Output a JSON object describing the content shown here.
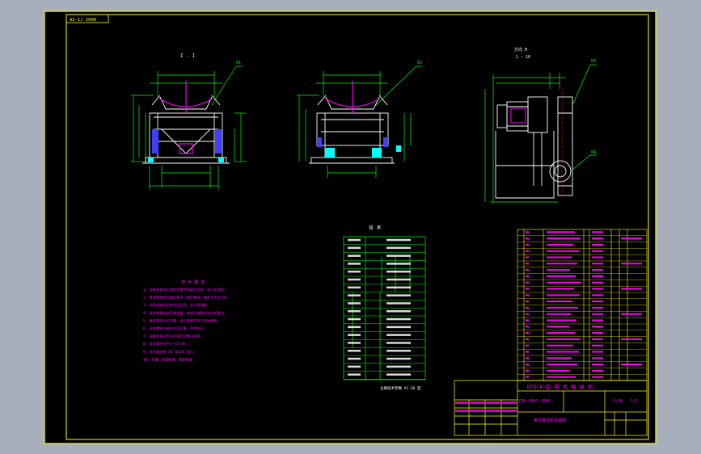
{
  "drawing": {
    "corner_label": "A3-1/ 1000",
    "view_label_left": "I - I",
    "view_label_right": "方向 H",
    "view_sublabel_right": "1 : 10",
    "specs_title": "技  术",
    "notes_title": "技 术 要 求",
    "notes": [
      "1. 设备安装前应清除各零件表面的毛刺、油污及锈蚀。",
      "2. 各滚筒轴线与输送带中心线应垂直，偏差不大于2mm。",
      "3. 托辊组安装后转动应灵活，无卡阻现象。",
      "4. 驱动装置安装后减速器、电机应按要求加注润滑油。",
      "5. 输送带接头应平整，接头强度不低于带体强度。",
      "6. 全部螺栓连接应牢固可靠，不得松动。",
      "7. 设备安装完毕后应进行空载试运转。",
      "8. 试运转时间不少于2小时。",
      "9. 其他要求按 GB 50270 执行。",
      "10. 涂漆：底漆两道，面漆两道。"
    ],
    "specs_footer": "主要技术参数 A1-30 型",
    "title_block": {
      "product_name": "DTⅡ(A)型  带 式 输 送 机 ",
      "drawing_no": "DTⅡ 0001-1000",
      "scale": "1:20",
      "sheet": "1/1",
      "company": "带式输送机总装图"
    }
  },
  "callouts": [
    "01",
    "02",
    "03",
    "04"
  ],
  "colors": {
    "background": "#000000",
    "frame": "#ffff00",
    "outline": "#ffffff",
    "dimension": "#00ff00",
    "magenta": "#ff00ff",
    "blue": "#3f3fff",
    "cyan": "#00ffff",
    "red": "#ff0000",
    "ui_backdrop": "#a6afbb"
  }
}
